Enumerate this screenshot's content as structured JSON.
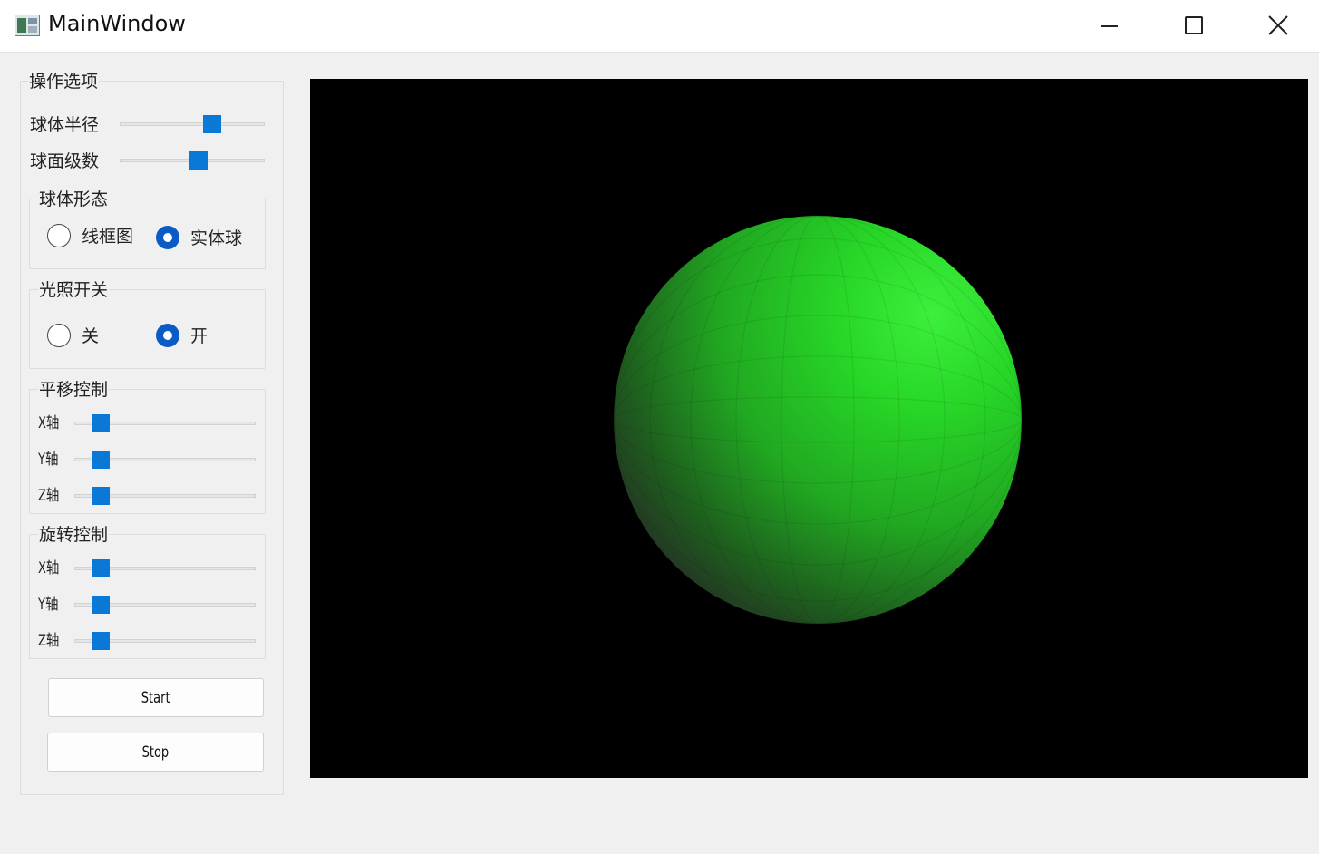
{
  "window": {
    "title": "MainWindow",
    "buttons": {
      "minimize": "minimize-icon",
      "maximize": "maximize-icon",
      "close": "close-icon"
    }
  },
  "options": {
    "title": "操作选项",
    "sphere_radius": {
      "label": "球体半径",
      "value": 0.7
    },
    "sphere_levels": {
      "label": "球面级数",
      "value": 0.56
    },
    "shape": {
      "title": "球体形态",
      "options": [
        "线框图",
        "实体球"
      ],
      "selected": "实体球"
    },
    "lighting": {
      "title": "光照开关",
      "options": [
        "关",
        "开"
      ],
      "selected": "开"
    },
    "translate": {
      "title": "平移控制",
      "axes": [
        {
          "label": "X轴",
          "value": 0.0
        },
        {
          "label": "Y轴",
          "value": 0.0
        },
        {
          "label": "Z轴",
          "value": 0.0
        }
      ]
    },
    "rotate": {
      "title": "旋转控制",
      "axes": [
        {
          "label": "X轴",
          "value": 0.0
        },
        {
          "label": "Y轴",
          "value": 0.0
        },
        {
          "label": "Z轴",
          "value": 0.0
        }
      ]
    },
    "start_label": "Start",
    "stop_label": "Stop"
  },
  "viewport": {
    "background": "#000000",
    "sphere_color": "#22e022",
    "render_mode": "solid"
  }
}
